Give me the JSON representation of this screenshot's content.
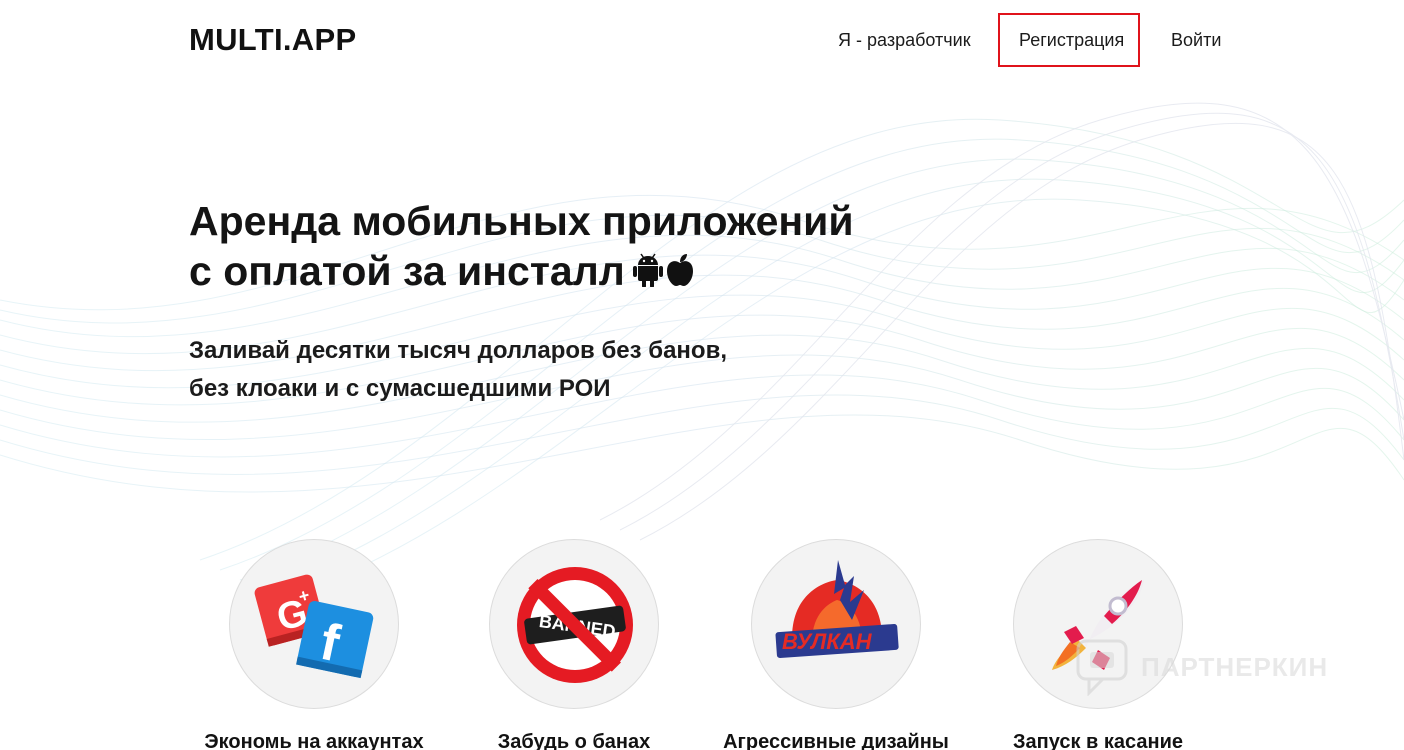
{
  "header": {
    "logo": "MULTI.APP",
    "nav": {
      "developer": "Я - разработчик",
      "register": "Регистрация",
      "login": "Войти"
    }
  },
  "hero": {
    "title_line1": "Аренда мобильных приложений",
    "title_line2": "с оплатой за инсталл",
    "subtitle_line1": "Заливай десятки тысяч долларов без банов,",
    "subtitle_line2": "без клоаки и с сумасшедшими РОИ"
  },
  "features": [
    {
      "label": "Экономь на аккаунтах",
      "icon": "google-plus-facebook-icon"
    },
    {
      "label": "Забудь о банах",
      "icon": "banned-icon"
    },
    {
      "label": "Агрессивные дизайны",
      "icon": "vulkan-logo-icon"
    },
    {
      "label": "Запуск в касание",
      "icon": "rocket-icon"
    }
  ],
  "watermark": "ПАРТНЕРКИН",
  "colors": {
    "highlight_box": "#e0131b",
    "banned_red": "#e51b23",
    "facebook_blue": "#1d8fe0",
    "google_red": "#ef3b3b"
  }
}
